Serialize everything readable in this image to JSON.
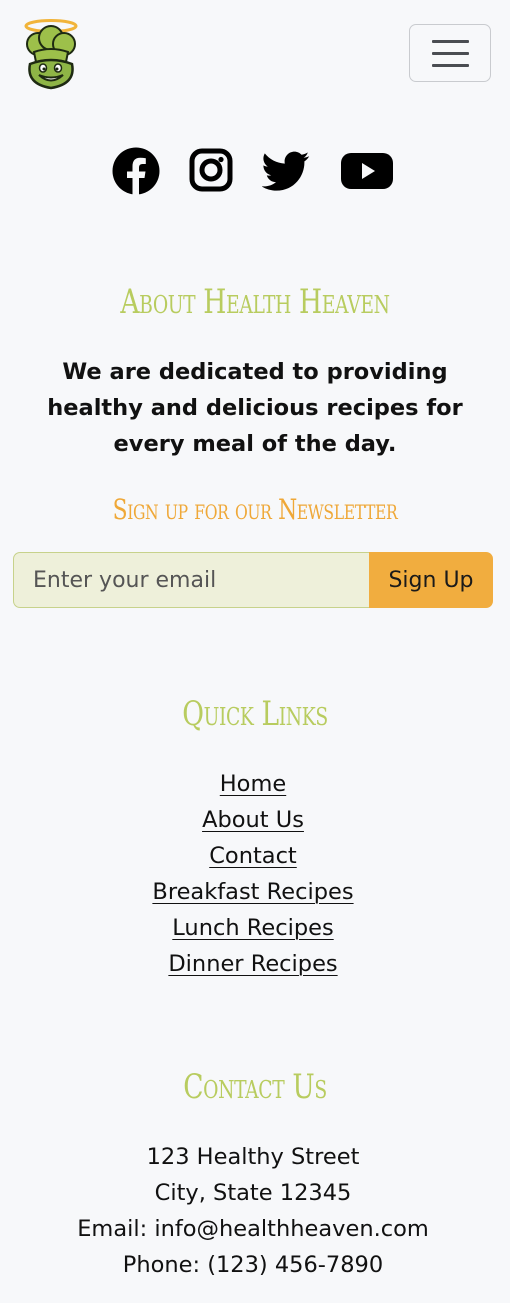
{
  "header": {
    "logo_icon": "angel-chef-broccoli-logo",
    "menu_icon": "hamburger-menu-icon"
  },
  "social": [
    {
      "name": "facebook-icon"
    },
    {
      "name": "instagram-icon"
    },
    {
      "name": "twitter-icon"
    },
    {
      "name": "youtube-icon"
    }
  ],
  "about": {
    "title": "About Health Heaven",
    "text": "We are dedicated to providing healthy and delicious recipes for every meal of the day."
  },
  "newsletter": {
    "title": "Sign up for our Newsletter",
    "placeholder": "Enter your email",
    "button_label": "Sign Up"
  },
  "quick_links": {
    "title": "Quick Links",
    "items": [
      {
        "label": "Home"
      },
      {
        "label": "About Us"
      },
      {
        "label": "Contact"
      },
      {
        "label": "Breakfast Recipes"
      },
      {
        "label": "Lunch Recipes"
      },
      {
        "label": "Dinner Recipes"
      }
    ]
  },
  "contact": {
    "title": "Contact Us",
    "address": "123 Healthy Street",
    "city": "City, State 12345",
    "email": "Email: info@healthheaven.com",
    "phone": "Phone: (123) 456-7890"
  },
  "colors": {
    "background": "#f7f8fa",
    "green_heading": "#b8cc5f",
    "orange_heading": "#efa838",
    "button": "#f1ad3f",
    "input_bg": "#eef0da"
  }
}
